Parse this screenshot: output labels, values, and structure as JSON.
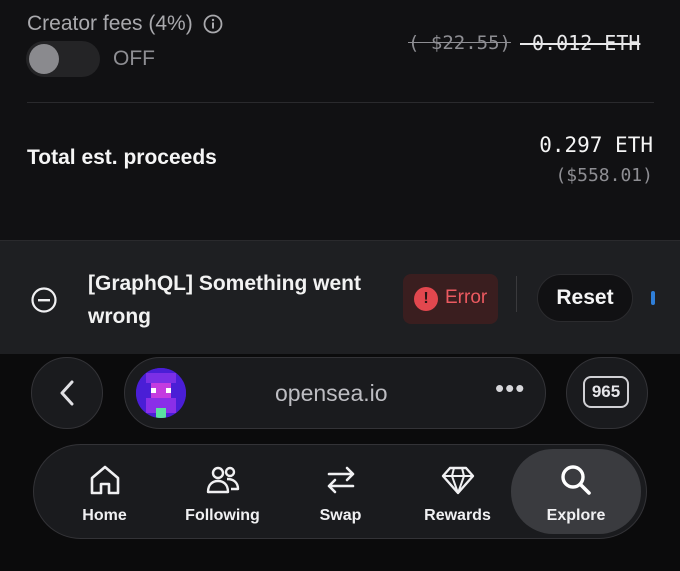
{
  "listing": {
    "creator_fees_label": "Creator fees (4%)",
    "toggle_state": "OFF",
    "creator_fee_usd": "( $22.55)",
    "creator_fee_eth": "-0.012 ETH",
    "total_label": "Total est. proceeds",
    "total_eth": "0.297 ETH",
    "total_usd": "($558.01)"
  },
  "toast": {
    "message": "[GraphQL] Something went wrong",
    "badge": "Error",
    "reset_label": "Reset"
  },
  "browser": {
    "url": "opensea.io",
    "menu_dots": "•••",
    "tab_count": "965"
  },
  "tabbar": {
    "items": [
      {
        "label": "Home",
        "icon": "home-icon"
      },
      {
        "label": "Following",
        "icon": "people-icon"
      },
      {
        "label": "Swap",
        "icon": "swap-icon"
      },
      {
        "label": "Rewards",
        "icon": "diamond-icon"
      },
      {
        "label": "Explore",
        "icon": "search-icon",
        "active": true
      }
    ]
  },
  "colors": {
    "error": "#e2474e",
    "accent_blue": "#2f7ed8",
    "avatar": "#4a1ed6"
  }
}
